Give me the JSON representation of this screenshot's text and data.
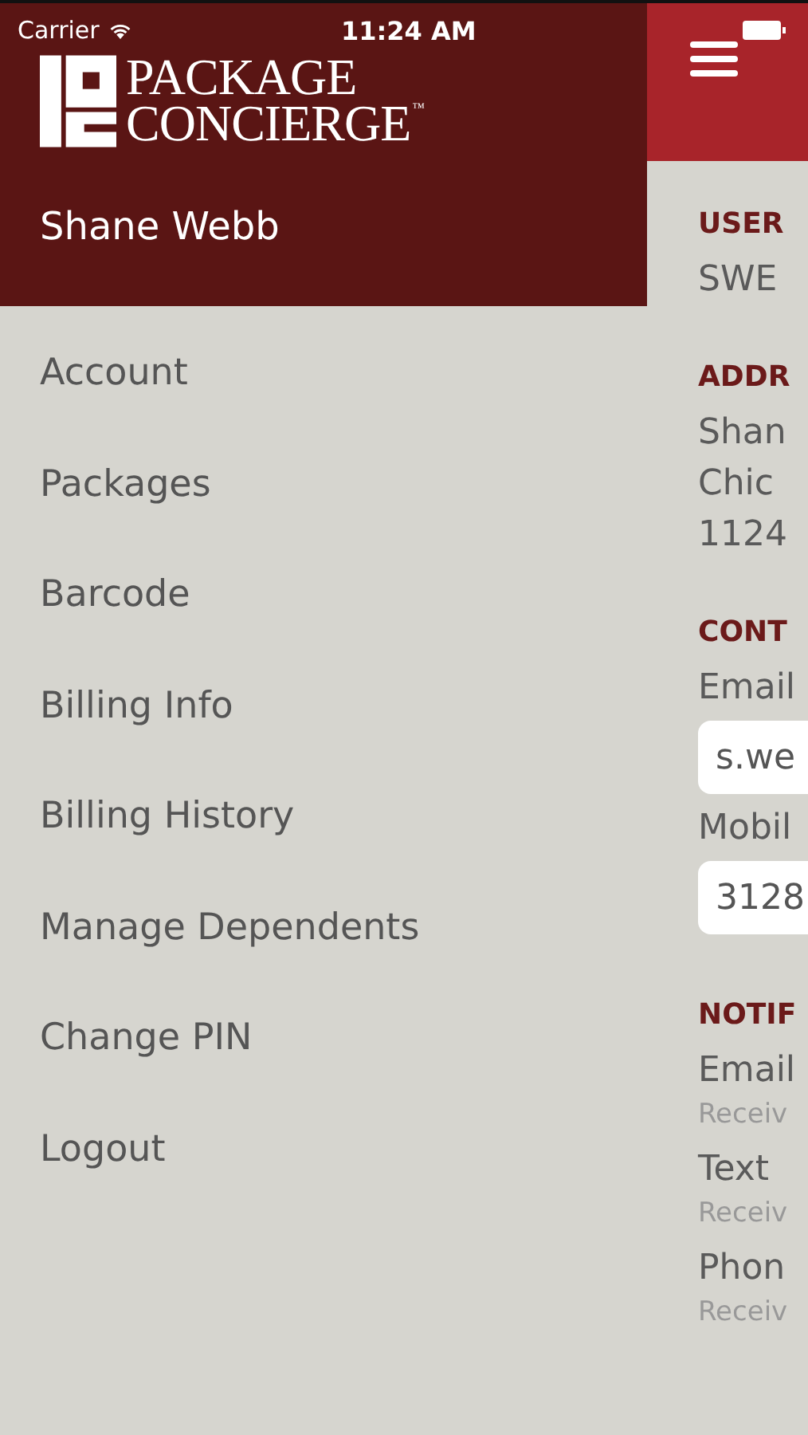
{
  "status_bar": {
    "carrier": "Carrier",
    "time": "11:24 AM"
  },
  "drawer": {
    "logo": {
      "lines": [
        "PACKAGE",
        "CONCIERGE"
      ],
      "trademark": "™"
    },
    "user_name": "Shane Webb",
    "items": [
      {
        "label": "Account"
      },
      {
        "label": "Packages"
      },
      {
        "label": "Barcode"
      },
      {
        "label": "Billing Info"
      },
      {
        "label": "Billing History"
      },
      {
        "label": "Manage Dependents"
      },
      {
        "label": "Change PIN"
      },
      {
        "label": "Logout"
      }
    ]
  },
  "main": {
    "sections": [
      {
        "heading": "USER",
        "kind": "lines",
        "lines": [
          "SWE"
        ]
      },
      {
        "heading": "ADDR",
        "kind": "lines",
        "lines": [
          "Shan",
          "Chic",
          "1124"
        ]
      },
      {
        "heading": "CONT",
        "kind": "fields",
        "fields": [
          {
            "label": "Email",
            "value": "s.we"
          },
          {
            "label": "Mobil",
            "value": "3128"
          }
        ]
      },
      {
        "heading": "NOTIF",
        "kind": "options",
        "options": [
          {
            "label": "Email",
            "description": "Receiv"
          },
          {
            "label": "Text",
            "description": "Receiv"
          },
          {
            "label": "Phon",
            "description": "Receiv"
          }
        ]
      }
    ]
  }
}
